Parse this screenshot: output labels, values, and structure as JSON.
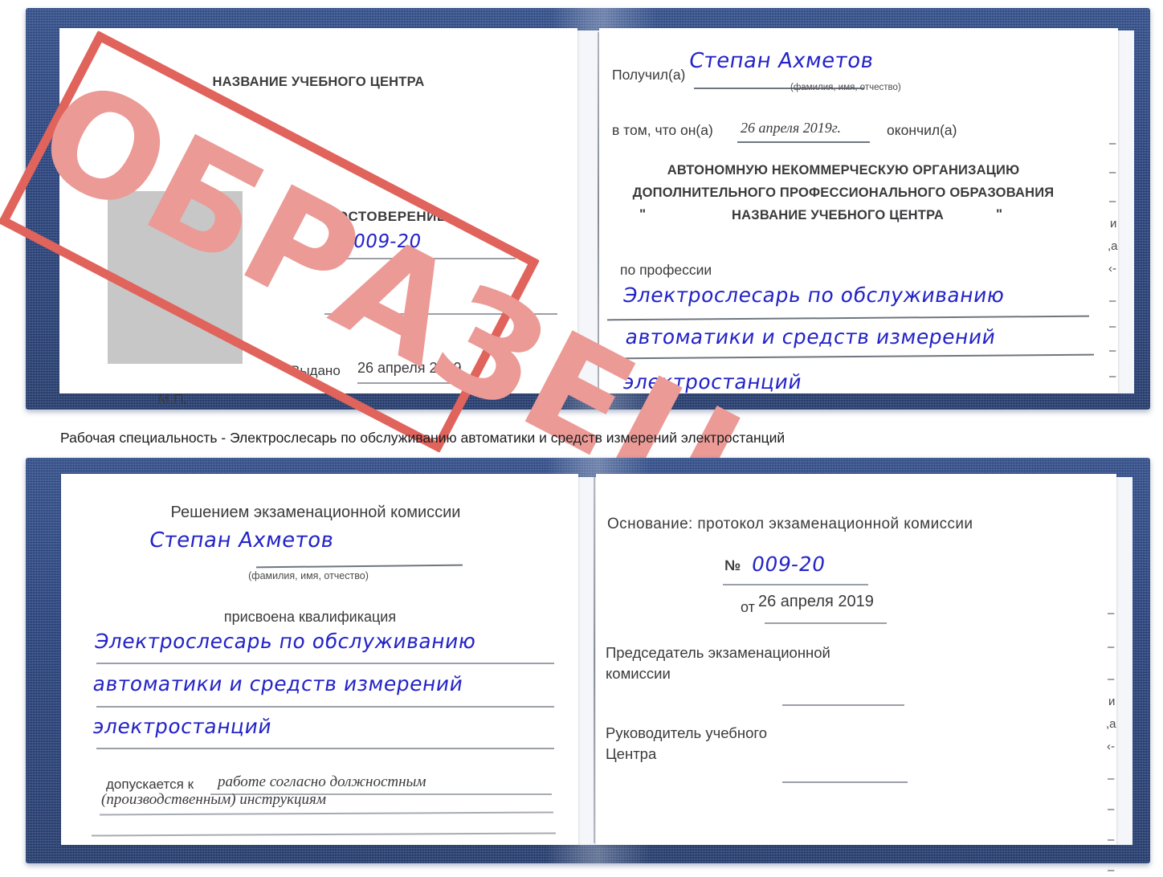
{
  "document": {
    "type": "certificate",
    "caption": "Рабочая специальность - Электрослесарь по обслуживанию автоматики и средств измерений электростанций",
    "watermark": "ОБРАЗЕЦ",
    "colors": {
      "cover": "#224084",
      "handwriting": "#2323c8",
      "stamp": "#e0635c",
      "stamp_text": "#eb9a96",
      "rule": "#9b9fa6",
      "photo_placeholder": "#c7c7c7"
    }
  },
  "certificate_top": {
    "left_page": {
      "center_name": "НАЗВАНИЕ УЧЕБНОГО ЦЕНТРА",
      "doc_title": "УДОСТОВЕРЕНИЕ",
      "number_label": "№",
      "number_value": "009-20",
      "issued_label": "Выдано",
      "issued_value": "26 апреля 2019",
      "seal_label": "М.П."
    },
    "right_page": {
      "received_label": "Получил(а)",
      "received_value": "Степан Ахметов",
      "fio_hint": "(фамилия, имя, отчество)",
      "that_he_label": "в том, что он(а)",
      "that_he_value": "26 апреля 2019г.",
      "graduated_label": "окончил(а)",
      "org_line_1": "АВТОНОМНУЮ НЕКОММЕРЧЕСКУЮ ОРГАНИЗАЦИЮ",
      "org_line_2": "ДОПОЛНИТЕЛЬНОГО ПРОФЕССИОНАЛЬНОГО ОБРАЗОВАНИЯ",
      "org_quote_open": "\"",
      "org_line_3": "НАЗВАНИЕ УЧЕБНОГО ЦЕНТРА",
      "org_quote_close": "\"",
      "profession_label": "по профессии",
      "profession_line_1": "Электрослесарь по обслуживанию",
      "profession_line_2": "автоматики и средств измерений",
      "profession_line_3": "электростанций",
      "edge_fragments": [
        "–",
        "–",
        "–",
        "и",
        ",а",
        "‹-",
        "–",
        "–",
        "–",
        "–"
      ]
    }
  },
  "certificate_bottom": {
    "left_page": {
      "heading": "Решением экзаменационной комиссии",
      "name_value": "Степан Ахметов",
      "fio_hint": "(фамилия, имя, отчество)",
      "qualification_label": "присвоена квалификация",
      "qualification_line_1": "Электрослесарь по обслуживанию",
      "qualification_line_2": "автоматики и средств измерений",
      "qualification_line_3": "электростанций",
      "allowed_label": "допускается к",
      "allowed_value_1": "работе согласно должностным",
      "allowed_value_2": "(производственным) инструкциям"
    },
    "right_page": {
      "basis_label": "Основание: протокол экзаменационной комиссии",
      "number_label": "№",
      "number_value": "009-20",
      "date_label": "от",
      "date_value": "26 апреля 2019",
      "chairman_line_1": "Председатель экзаменационной",
      "chairman_line_2": "комиссии",
      "head_line_1": "Руководитель учебного",
      "head_line_2": "Центра",
      "edge_fragments": [
        "–",
        "–",
        "–",
        "и",
        ",а",
        "‹-",
        "–",
        "–",
        "–",
        "–"
      ]
    }
  }
}
